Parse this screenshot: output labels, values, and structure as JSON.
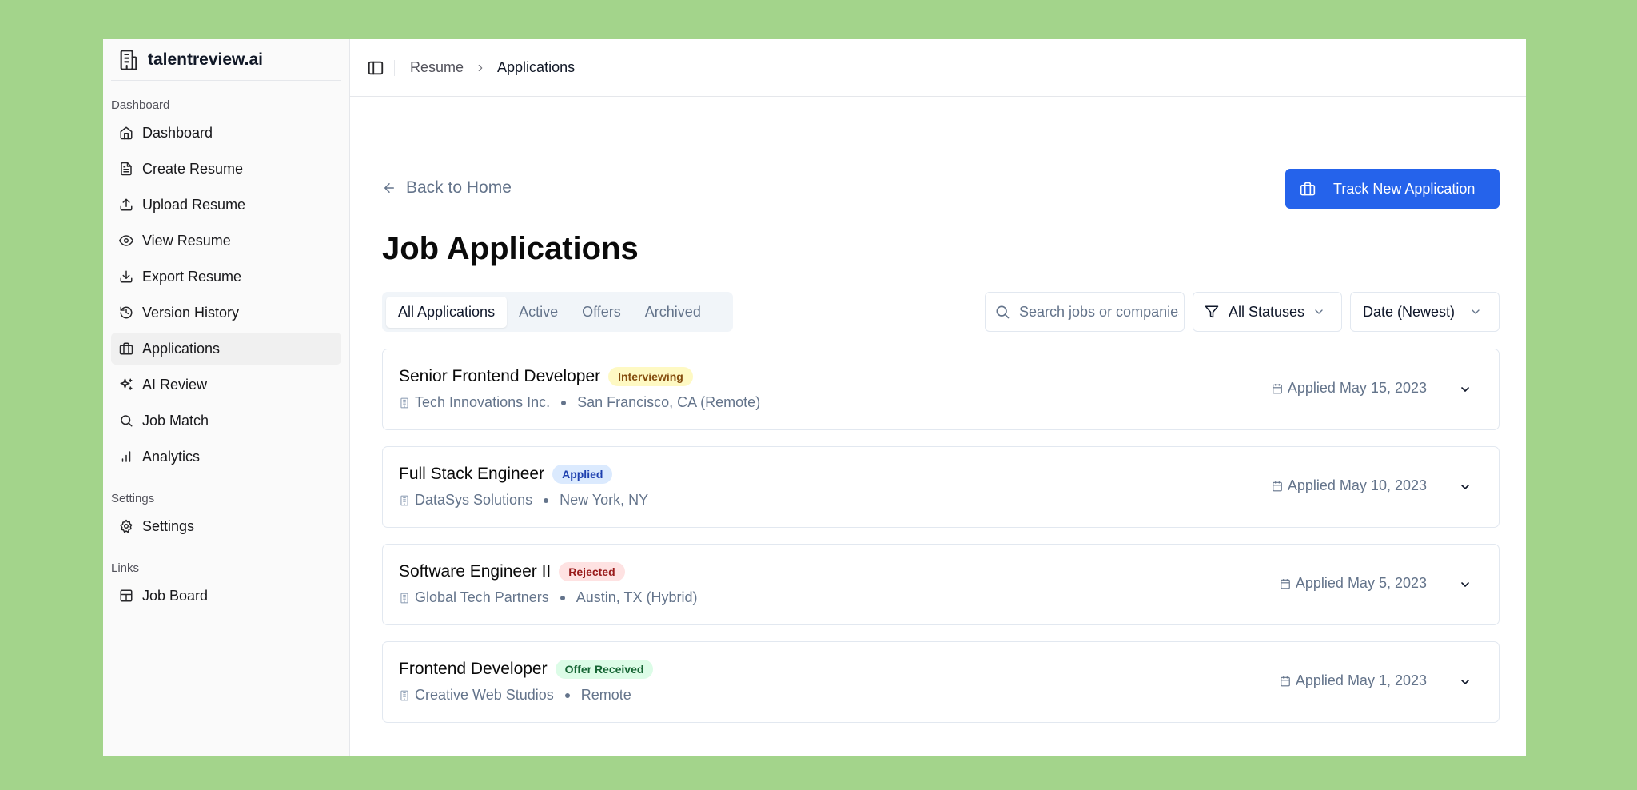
{
  "brand": {
    "name": "talentreview.ai",
    "icon": "building-icon"
  },
  "sidebar": {
    "groups": [
      {
        "label": "Dashboard",
        "items": [
          {
            "label": "Dashboard",
            "icon": "home-icon"
          },
          {
            "label": "Create Resume",
            "icon": "file-text-icon"
          },
          {
            "label": "Upload Resume",
            "icon": "upload-icon"
          },
          {
            "label": "View Resume",
            "icon": "eye-icon"
          },
          {
            "label": "Export Resume",
            "icon": "download-icon"
          },
          {
            "label": "Version History",
            "icon": "history-icon"
          },
          {
            "label": "Applications",
            "icon": "briefcase-icon",
            "active": true
          },
          {
            "label": "AI Review",
            "icon": "sparkles-icon"
          },
          {
            "label": "Job Match",
            "icon": "search-icon"
          },
          {
            "label": "Analytics",
            "icon": "bar-chart-icon"
          }
        ]
      },
      {
        "label": "Settings",
        "items": [
          {
            "label": "Settings",
            "icon": "gear-icon"
          }
        ]
      },
      {
        "label": "Links",
        "items": [
          {
            "label": "Job Board",
            "icon": "layout-icon"
          }
        ]
      }
    ]
  },
  "breadcrumb": {
    "parent": "Resume",
    "current": "Applications"
  },
  "main": {
    "back_label": "Back to Home",
    "track_button_label": "Track New Application",
    "title": "Job Applications",
    "tabs": [
      "All Applications",
      "Active",
      "Offers",
      "Archived"
    ],
    "active_tab": "All Applications",
    "search_placeholder": "Search jobs or companies",
    "status_filter": "All Statuses",
    "sort": "Date (Newest)"
  },
  "applications": [
    {
      "title": "Senior Frontend Developer",
      "status": "Interviewing",
      "status_class": "interviewing",
      "company": "Tech Innovations Inc.",
      "location": "San Francisco, CA (Remote)",
      "applied": "Applied May 15, 2023"
    },
    {
      "title": "Full Stack Engineer",
      "status": "Applied",
      "status_class": "applied",
      "company": "DataSys Solutions",
      "location": "New York, NY",
      "applied": "Applied May 10, 2023"
    },
    {
      "title": "Software Engineer II",
      "status": "Rejected",
      "status_class": "rejected",
      "company": "Global Tech Partners",
      "location": "Austin, TX (Hybrid)",
      "applied": "Applied May 5, 2023"
    },
    {
      "title": "Frontend Developer",
      "status": "Offer Received",
      "status_class": "offer",
      "company": "Creative Web Studios",
      "location": "Remote",
      "applied": "Applied May 1, 2023"
    }
  ],
  "colors": {
    "background": "#a3d48b",
    "accent": "#2563eb"
  }
}
